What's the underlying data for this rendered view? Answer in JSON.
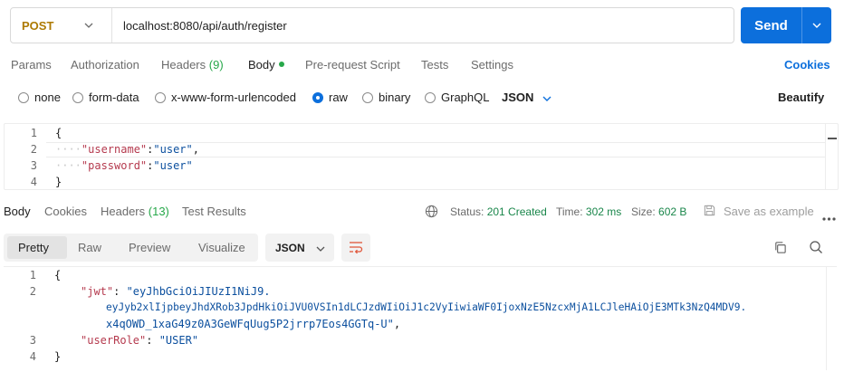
{
  "request": {
    "method": "POST",
    "url": "localhost:8080/api/auth/register",
    "send_label": "Send"
  },
  "req_tabs": {
    "params": "Params",
    "authorization": "Authorization",
    "headers": "Headers",
    "headers_count": "(9)",
    "body": "Body",
    "pre_request": "Pre-request Script",
    "tests": "Tests",
    "settings": "Settings",
    "cookies": "Cookies"
  },
  "body_types": {
    "none": "none",
    "form_data": "form-data",
    "urlencoded": "x-www-form-urlencoded",
    "raw": "raw",
    "binary": "binary",
    "graphql": "GraphQL",
    "language": "JSON",
    "beautify": "Beautify"
  },
  "request_body": {
    "lines": [
      "1",
      "2",
      "3",
      "4"
    ],
    "open_brace": "{",
    "close_brace": "}",
    "indent": "····",
    "username_key": "\"username\"",
    "username_val": "\"user\"",
    "password_key": "\"password\"",
    "password_val": "\"user\"",
    "colon": ":",
    "comma": ","
  },
  "res_tabs": {
    "body": "Body",
    "cookies": "Cookies",
    "headers": "Headers",
    "headers_count": "(13)",
    "test_results": "Test Results"
  },
  "status": {
    "status_label": "Status:",
    "status_value": "201 Created",
    "time_label": "Time:",
    "time_value": "302 ms",
    "size_label": "Size:",
    "size_value": "602 B",
    "save_example": "Save as example"
  },
  "res_toolbar": {
    "pretty": "Pretty",
    "raw": "Raw",
    "preview": "Preview",
    "visualize": "Visualize",
    "format": "JSON"
  },
  "response_body": {
    "lines": [
      "1",
      "2",
      "3",
      "4"
    ],
    "open_brace": "{",
    "close_brace": "}",
    "jwt_key": "\"jwt\"",
    "jwt_line1": "\"eyJhbGciOiJIUzI1NiJ9.",
    "jwt_line2": "eyJyb2xlIjpbeyJhdXRob3JpdHkiOiJVU0VSIn1dLCJzdWIiOiJ1c2VyIiwiaWF0IjoxNzE5NzcxMjA1LCJleHAiOjE3MTk3NzQ4MDV9.",
    "jwt_line3": "x4qOWD_1xaG49z0A3GeWFqUug5P2jrrp7Eos4GGTq-U\"",
    "user_role_key": "\"userRole\"",
    "user_role_val": "\"USER\"",
    "colon_sp": ": ",
    "comma": ","
  },
  "colors": {
    "accent": "#0c6fdc",
    "method": "#ad7a03",
    "success": "#19864a"
  }
}
